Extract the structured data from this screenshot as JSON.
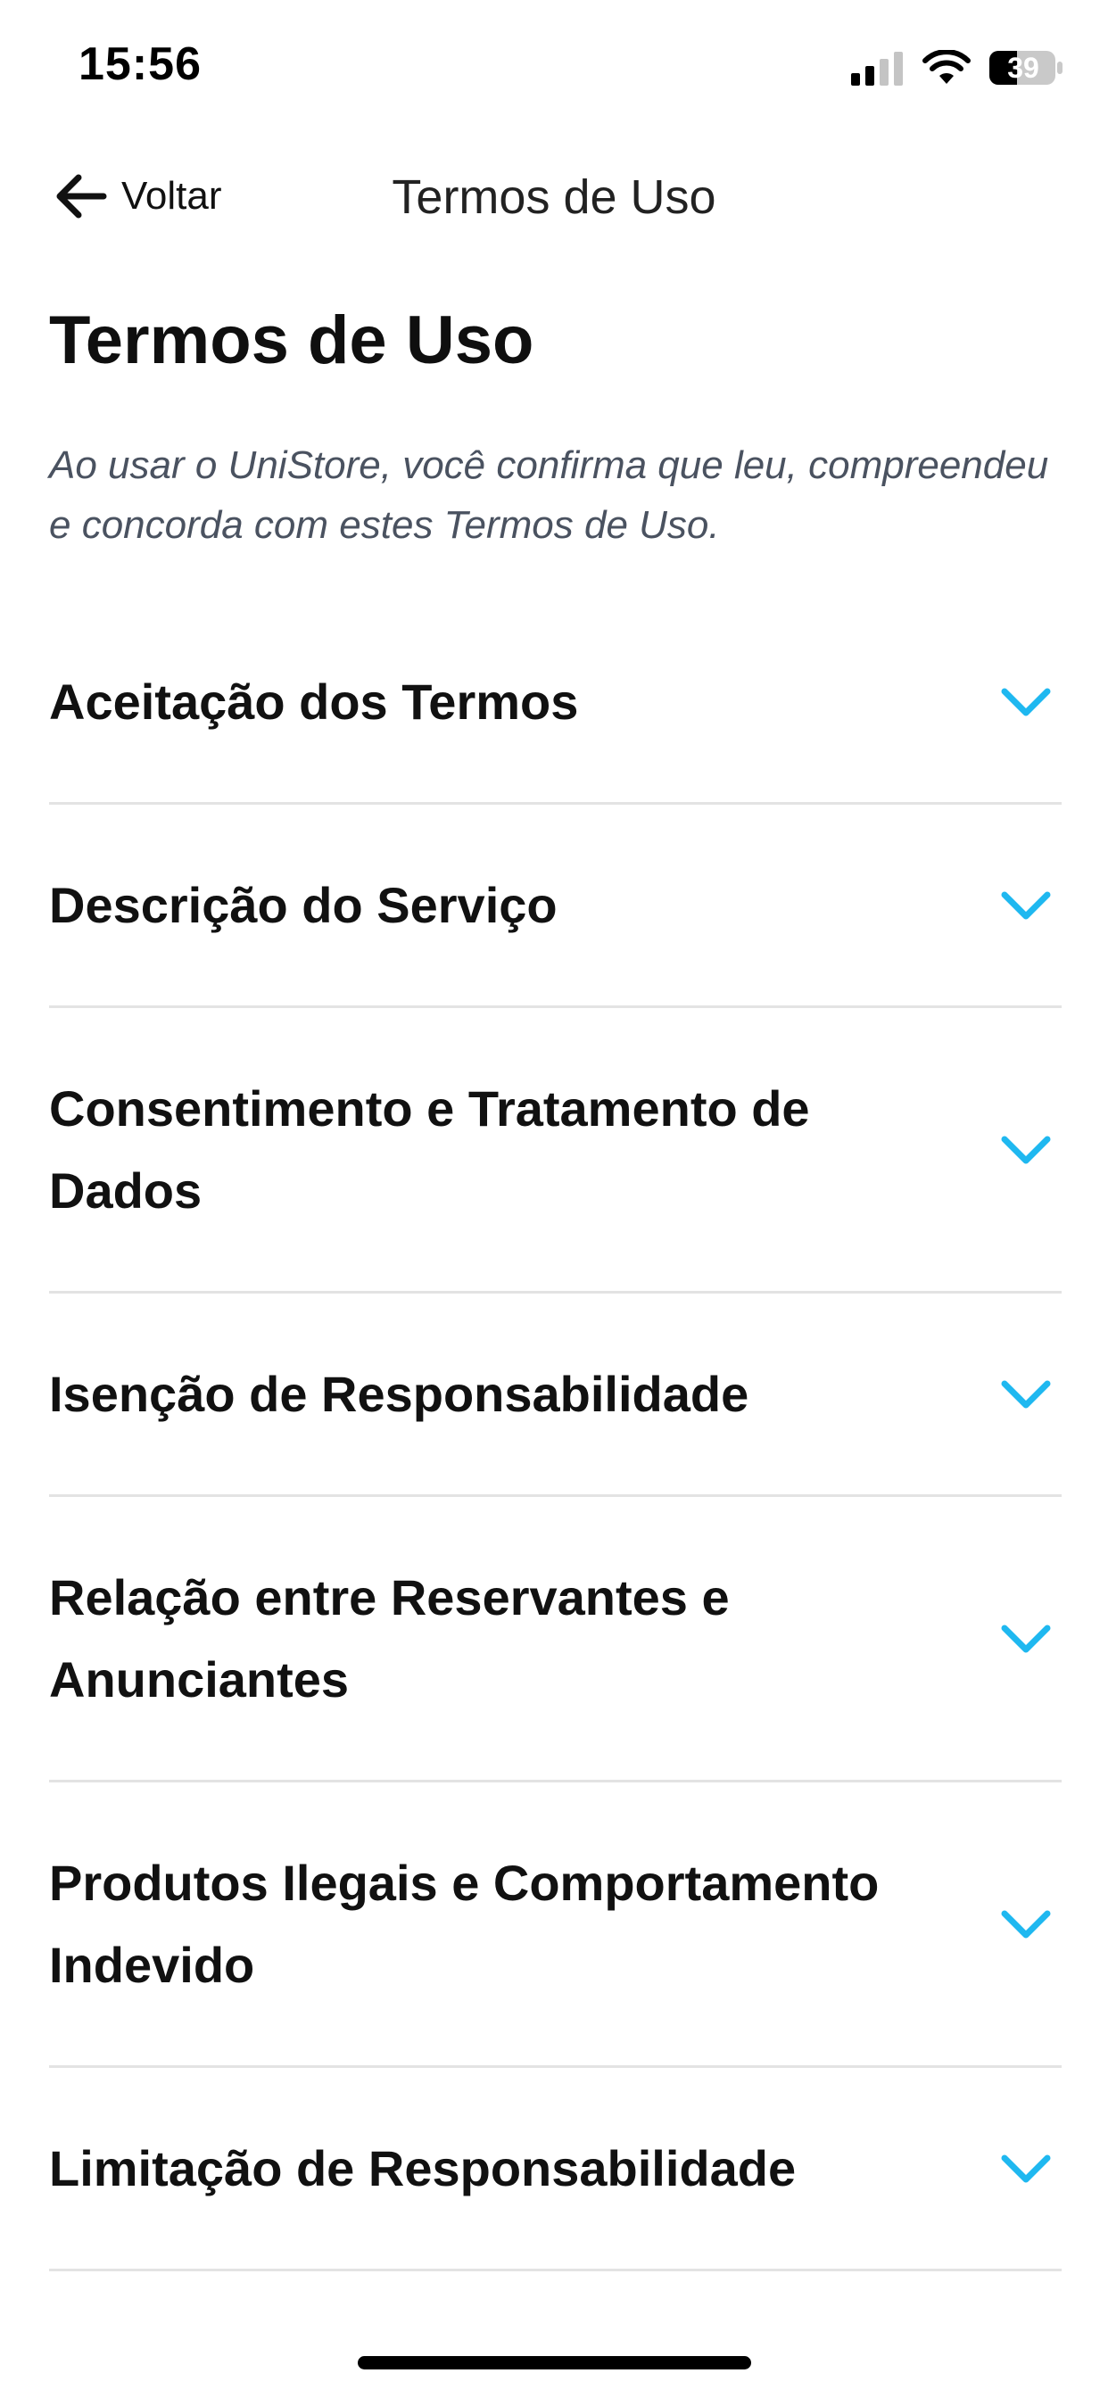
{
  "status_bar": {
    "time": "15:56",
    "battery_level": "39",
    "icons": [
      "signal-icon",
      "wifi-icon",
      "battery-icon"
    ]
  },
  "nav": {
    "back_label": "Voltar",
    "back_icon": "arrow-left-icon",
    "title": "Termos de Uso"
  },
  "page": {
    "heading": "Termos de Uso",
    "intro": "Ao usar o UniStore, você confirma que leu, compreendeu e concorda com estes Termos de Uso."
  },
  "sections": [
    {
      "title": "Aceitação dos Termos",
      "expanded": false
    },
    {
      "title": "Descrição do Serviço",
      "expanded": false
    },
    {
      "title": "Consentimento e Tratamento de Dados",
      "expanded": false
    },
    {
      "title": "Isenção de Responsabilidade",
      "expanded": false
    },
    {
      "title": "Relação entre Reservantes e Anunciantes",
      "expanded": false
    },
    {
      "title": "Produtos Ilegais e Comportamento Indevido",
      "expanded": false
    },
    {
      "title": "Limitação de Responsabilidade",
      "expanded": false
    }
  ],
  "colors": {
    "accent": "#1fb8f0",
    "divider": "#e3e3e3",
    "intro_text": "#4a5260"
  }
}
